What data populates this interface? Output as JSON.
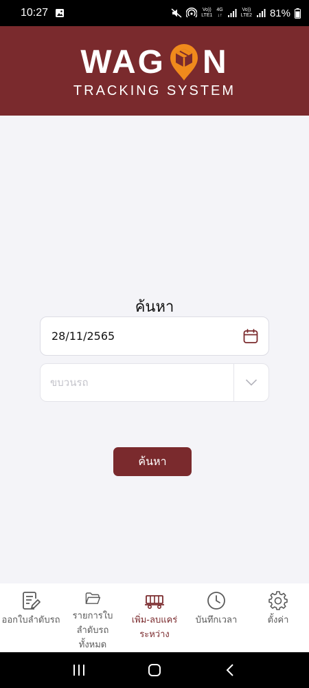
{
  "status_bar": {
    "time": "10:27",
    "net1_top": "Vo))",
    "net1_bottom": "LTE1",
    "net_type": "4G",
    "net2_top": "Vo))",
    "net2_bottom": "LTE2",
    "battery": "81%"
  },
  "header": {
    "logo_left": "WAG",
    "logo_right": "N",
    "subtitle": "TRACKING SYSTEM",
    "brand_color": "#7a2a2d",
    "accent_color": "#f08a1c"
  },
  "search": {
    "title": "ค้นหา",
    "date_value": "28/11/2565",
    "train_placeholder": "ขบวนรถ",
    "button_label": "ค้นหา"
  },
  "bottom_nav": {
    "items": [
      {
        "label": "ออกใบลำดับรถ",
        "icon": "edit-document-icon",
        "active": false
      },
      {
        "label_line1": "รายการใบ",
        "label_line2": "ลำดับรถ",
        "label_line3": "ทั้งหมด",
        "icon": "folder-icon",
        "active": false
      },
      {
        "label_line1": "เพิ่ม-ลบแคร่",
        "label_line2": "ระหว่าง",
        "icon": "train-car-icon",
        "active": true
      },
      {
        "label": "บันทึกเวลา",
        "icon": "clock-icon",
        "active": false
      },
      {
        "label": "ตั้งค่า",
        "icon": "gear-icon",
        "active": false
      }
    ]
  }
}
